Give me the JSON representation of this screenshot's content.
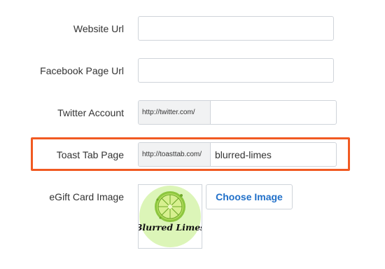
{
  "form": {
    "website_url": {
      "label": "Website Url",
      "value": ""
    },
    "facebook_page_url": {
      "label": "Facebook Page Url",
      "value": ""
    },
    "twitter_account": {
      "label": "Twitter Account",
      "prefix": "http://twitter.com/",
      "value": ""
    },
    "toast_tab_page": {
      "label": "Toast Tab Page",
      "prefix": "http://toasttab.com/",
      "value": "blurred-limes"
    },
    "egift_card_image": {
      "label": "eGift Card Image",
      "logo_text": "Blurred Limes",
      "choose_button": "Choose Image"
    }
  },
  "colors": {
    "highlight": "#f15a22",
    "link_blue": "#2170c9",
    "logo_bg": "#dcf5b8",
    "lime": "#7ab829"
  }
}
